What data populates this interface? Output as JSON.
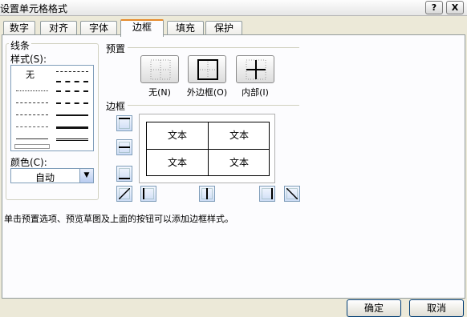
{
  "window": {
    "title": "设置单元格格式",
    "help_label": "?",
    "close_label": "X"
  },
  "tabs": [
    {
      "label": "数字"
    },
    {
      "label": "对齐"
    },
    {
      "label": "字体"
    },
    {
      "label": "边框",
      "active": true
    },
    {
      "label": "填充"
    },
    {
      "label": "保护"
    }
  ],
  "line_group": {
    "title": "线条",
    "style_label": "样式(S):",
    "none_label": "无",
    "color_label": "颜色(C):",
    "color_value": "自动"
  },
  "presets": {
    "title": "预置",
    "items": [
      {
        "label": "无(N)",
        "icon": "no-border-icon"
      },
      {
        "label": "外边框(O)",
        "icon": "outline-border-icon"
      },
      {
        "label": "内部(I)",
        "icon": "inside-border-icon"
      }
    ]
  },
  "border": {
    "title": "边框",
    "preview_cells": [
      "文本",
      "文本",
      "文本",
      "文本"
    ]
  },
  "hint": "单击预置选项、预览草图及上面的按钮可以添加边框样式。",
  "buttons": {
    "ok_label": "确定",
    "cancel_label": "取消"
  }
}
